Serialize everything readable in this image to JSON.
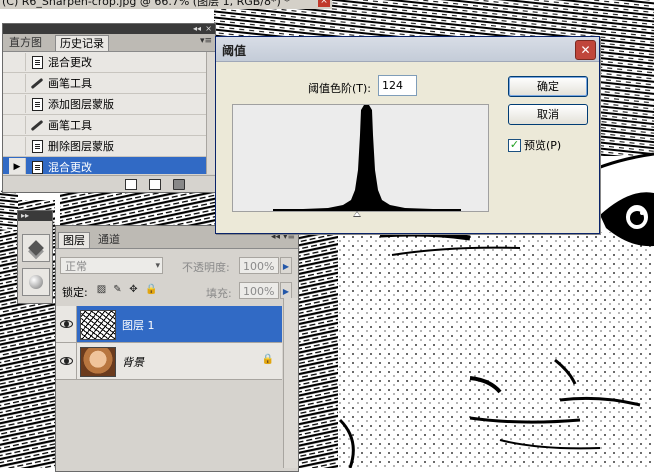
{
  "document": {
    "title": "(C) R6_Sharpen-crop.jpg @ 66.7% (图层 1, RGB/8*) *"
  },
  "history_panel": {
    "tabs": [
      "直方图",
      "历史记录"
    ],
    "active_tab": 1,
    "items": [
      {
        "label": "混合更改",
        "icon": "document-icon"
      },
      {
        "label": "画笔工具",
        "icon": "brush-icon"
      },
      {
        "label": "添加图层蒙版",
        "icon": "document-icon"
      },
      {
        "label": "画笔工具",
        "icon": "brush-icon"
      },
      {
        "label": "删除图层蒙版",
        "icon": "document-icon"
      },
      {
        "label": "混合更改",
        "icon": "document-icon",
        "selected": true
      }
    ]
  },
  "layers_panel": {
    "tabs": [
      "图层",
      "通道"
    ],
    "blend_mode": "正常",
    "opacity_label": "不透明度:",
    "opacity_value": "100%",
    "lock_label": "锁定:",
    "fill_label": "填充:",
    "fill_value": "100%",
    "layers": [
      {
        "name": "图层 1",
        "selected": true
      },
      {
        "name": "背景",
        "locked": true
      }
    ]
  },
  "threshold_dialog": {
    "title": "阈值",
    "threshold_label": "阈值色阶(T):",
    "threshold_value": "124",
    "ok_label": "确定",
    "cancel_label": "取消",
    "preview_label": "预览(P)",
    "preview_checked": true
  },
  "colors": {
    "selection_blue": "#316ac5",
    "dialog_bg": "#ece9d8",
    "panel_bg": "#d6d3ce"
  }
}
